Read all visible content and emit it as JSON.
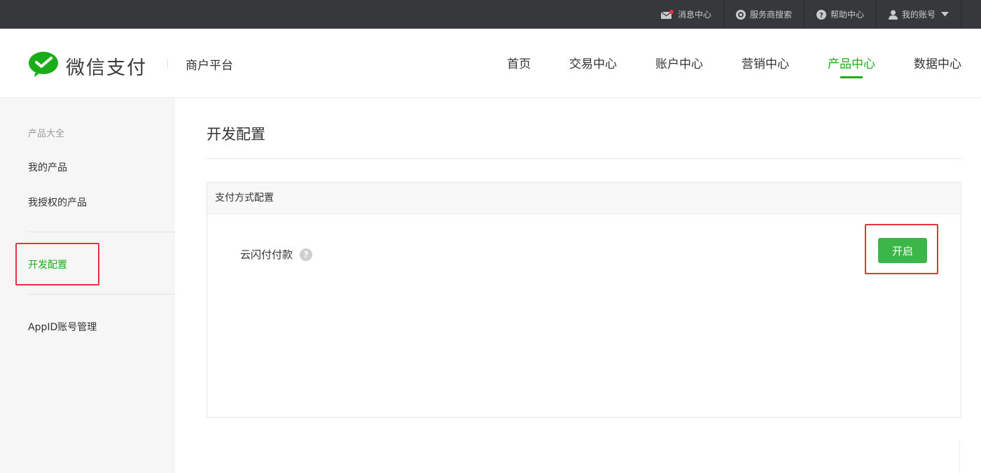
{
  "topbar": {
    "items": [
      {
        "label": "消息中心",
        "icon": "mail-icon"
      },
      {
        "label": "服务商搜索",
        "icon": "search-circle-icon"
      },
      {
        "label": "帮助中心",
        "icon": "help-circle-icon"
      },
      {
        "label": "我的账号",
        "icon": "user-icon"
      }
    ]
  },
  "header": {
    "logo_text": "微信支付",
    "platform": "商户平台",
    "nav": [
      {
        "label": "首页"
      },
      {
        "label": "交易中心"
      },
      {
        "label": "账户中心"
      },
      {
        "label": "营销中心"
      },
      {
        "label": "产品中心",
        "active": true
      },
      {
        "label": "数据中心"
      }
    ]
  },
  "sidebar": {
    "heading": "产品大全",
    "items": [
      {
        "label": "我的产品"
      },
      {
        "label": "我授权的产品"
      },
      {
        "label": "开发配置",
        "active": true
      },
      {
        "label": "AppID账号管理"
      }
    ]
  },
  "main": {
    "title": "开发配置",
    "panel": {
      "title": "支付方式配置",
      "row_label": "云闪付付款",
      "help_symbol": "?",
      "button_label": "开启"
    }
  },
  "colors": {
    "brand_green": "#1aad19",
    "button_green": "#3cb648",
    "highlight_red": "#e8333c",
    "topbar_bg": "#37383c"
  }
}
